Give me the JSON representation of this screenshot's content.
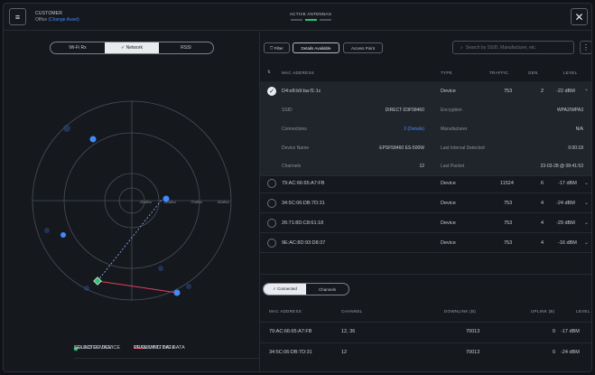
{
  "header": {
    "customer_label": "CUSTOMER",
    "customer_name": "Office",
    "change_link": "(Change Asset)",
    "active_antennas_label": "ACTIVE ANTENNAS",
    "menu_icon": "hamburger-icon",
    "close_icon": "close-icon"
  },
  "view_tabs": [
    "Wi-Fi Rx",
    "✓ Network",
    "RSSI"
  ],
  "radar": {
    "scale_labels": [
      "-50dBm",
      "-60dBm",
      "-70dBm",
      "-80dBm"
    ]
  },
  "legend": {
    "found_device": "FOUND DEVICE",
    "receiving_data": "RECEIVING DATA",
    "selected_device": "SELECTED DEVICE",
    "transmitting_data": "TRANSMITTING DATA",
    "colors": {
      "found": "#3d8cff",
      "selected": "#27c26d",
      "transmit": "#e2405b"
    }
  },
  "toolbar": {
    "filter": "Filter",
    "details_available": "Details Available",
    "access_point": "Access Point",
    "search_placeholder": "Search by SSID, Manufacturer, etc.",
    "more_icon": "more-vertical-icon"
  },
  "table": {
    "headers": {
      "mac": "MAC ADDRESS",
      "type": "TYPE",
      "traffic": "TRAFFIC",
      "gen": "GEN",
      "level": "LEVEL"
    },
    "selected": {
      "mac": "D4:e8:b9:ba:f1:1c",
      "type": "Device",
      "traffic": "753",
      "gen": "2",
      "level": "-22 dBM",
      "ssid_label": "SSID",
      "ssid": "DIRECT-D3F58460",
      "encryption_label": "Encryption",
      "encryption": "WPA2/WPA3",
      "connections_label": "Connections",
      "connections": "2 (Details)",
      "manufacturer_label": "Manufacturer",
      "manufacturer": "N/A",
      "device_name_label": "Device Name",
      "device_name": "EPSF58460 ES-500W",
      "last_interval_label": "Last Interval Detected",
      "last_interval": "0:00:18",
      "channels_label": "Channels",
      "channels": "12",
      "last_packet_label": "Last Packet",
      "last_packet": "23-03-28 @ 08:41:53"
    },
    "rows": [
      {
        "mac": "79:AC:66:65:A7:FB",
        "type": "Device",
        "traffic": "11524",
        "gen": "6",
        "level": "-17 dBM"
      },
      {
        "mac": "34:5C:06:DB:7D:31",
        "type": "Device",
        "traffic": "753",
        "gen": "4",
        "level": "-24 dBM"
      },
      {
        "mac": "26:71:8D:C8:61:18",
        "type": "Device",
        "traffic": "753",
        "gen": "4",
        "level": "-29 dBM"
      },
      {
        "mac": "9E:AC:8D:93:D8:37",
        "type": "Device",
        "traffic": "753",
        "gen": "4",
        "level": "-16 dBM"
      }
    ]
  },
  "connections_panel": {
    "tabs": [
      "✓ Connected",
      "Channels"
    ],
    "headers": {
      "mac": "MAC ADDRESS",
      "channel": "CHANNEL",
      "downlink": "DOWNLINK (B)",
      "uplink": "UPLINK (B)",
      "level": "LEVEL"
    },
    "rows": [
      {
        "mac": "79:AC:66:65:A7:FB",
        "channel": "12, 36",
        "downlink": "70013",
        "uplink": "0",
        "level": "-17 dBM"
      },
      {
        "mac": "34:5C:06:DB:7D:31",
        "channel": "12",
        "downlink": "70013",
        "uplink": "0",
        "level": "-24 dBM"
      }
    ]
  }
}
